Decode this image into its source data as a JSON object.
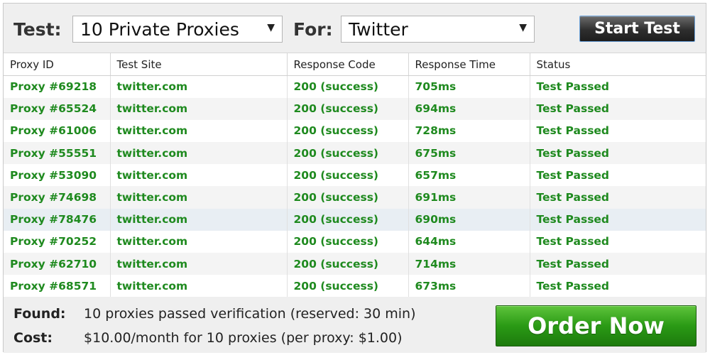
{
  "toolbar": {
    "test_label": "Test:",
    "test_value": "10 Private Proxies",
    "for_label": "For:",
    "for_value": "Twitter",
    "caret": "▼",
    "start_label": "Start Test"
  },
  "table": {
    "headers": [
      "Proxy ID",
      "Test Site",
      "Response Code",
      "Response Time",
      "Status"
    ],
    "rows": [
      [
        "Proxy #69218",
        "twitter.com",
        "200 (success)",
        "705ms",
        "Test Passed"
      ],
      [
        "Proxy #65524",
        "twitter.com",
        "200 (success)",
        "694ms",
        "Test Passed"
      ],
      [
        "Proxy #61006",
        "twitter.com",
        "200 (success)",
        "728ms",
        "Test Passed"
      ],
      [
        "Proxy #55551",
        "twitter.com",
        "200 (success)",
        "675ms",
        "Test Passed"
      ],
      [
        "Proxy #53090",
        "twitter.com",
        "200 (success)",
        "657ms",
        "Test Passed"
      ],
      [
        "Proxy #74698",
        "twitter.com",
        "200 (success)",
        "691ms",
        "Test Passed"
      ],
      [
        "Proxy #78476",
        "twitter.com",
        "200 (success)",
        "690ms",
        "Test Passed"
      ],
      [
        "Proxy #70252",
        "twitter.com",
        "200 (success)",
        "644ms",
        "Test Passed"
      ],
      [
        "Proxy #62710",
        "twitter.com",
        "200 (success)",
        "714ms",
        "Test Passed"
      ],
      [
        "Proxy #68571",
        "twitter.com",
        "200 (success)",
        "673ms",
        "Test Passed"
      ]
    ]
  },
  "footer": {
    "found_label": "Found:",
    "found_text": "10 proxies passed verification (reserved: 30 min)",
    "cost_label": "Cost:",
    "cost_text": "$10.00/month for 10 proxies (per proxy: $1.00)",
    "order_label": "Order Now"
  },
  "colors": {
    "success_text": "#1f8a1f",
    "order_button": "#2a9a15",
    "start_button": "#2e2e2e"
  }
}
